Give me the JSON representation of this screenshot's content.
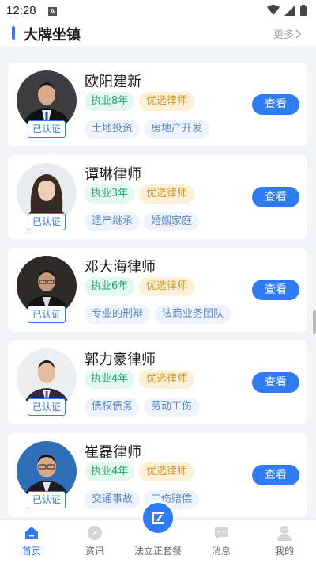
{
  "status": {
    "time": "12:28",
    "notify_letter": "A"
  },
  "header": {
    "title": "大牌坐镇",
    "more": "更多"
  },
  "colors": {
    "accent": "#2e7bf2",
    "years_bg": "#e3f8ee",
    "years_fg": "#2aa06d",
    "preferred_bg": "#fdf0d6",
    "preferred_fg": "#d69a2b",
    "field_bg": "#eef3fc",
    "field_fg": "#5e88c2"
  },
  "lawyers": [
    {
      "name": "欧阳建新",
      "years": "执业8年",
      "badge": "优选律师",
      "verified": "已认证",
      "fields": [
        "土地投资",
        "房地产开发"
      ],
      "action": "查看"
    },
    {
      "name": "谭琳律师",
      "years": "执业3年",
      "badge": "优选律师",
      "verified": "已认证",
      "fields": [
        "遗产继承",
        "婚姻家庭"
      ],
      "action": "查看"
    },
    {
      "name": "邓大海律师",
      "years": "执业6年",
      "badge": "优选律师",
      "verified": "已认证",
      "fields": [
        "专业的刑辩",
        "法商业务团队"
      ],
      "action": "查看"
    },
    {
      "name": "郭力豪律师",
      "years": "执业4年",
      "badge": "优选律师",
      "verified": "已认证",
      "fields": [
        "债权债务",
        "劳动工伤"
      ],
      "action": "查看"
    },
    {
      "name": "崔磊律师",
      "years": "执业4年",
      "badge": "优选律师",
      "verified": "已认证",
      "fields": [
        "交通事故",
        "工伤赔偿"
      ],
      "action": "查看"
    }
  ],
  "tabbar": {
    "items": [
      {
        "label": "首页",
        "icon": "home-icon",
        "active": true
      },
      {
        "label": "资讯",
        "icon": "compass-icon"
      },
      {
        "label": "法立正套餐",
        "icon": "package-logo-icon"
      },
      {
        "label": "消息",
        "icon": "message-icon"
      },
      {
        "label": "我的",
        "icon": "profile-icon"
      }
    ]
  }
}
